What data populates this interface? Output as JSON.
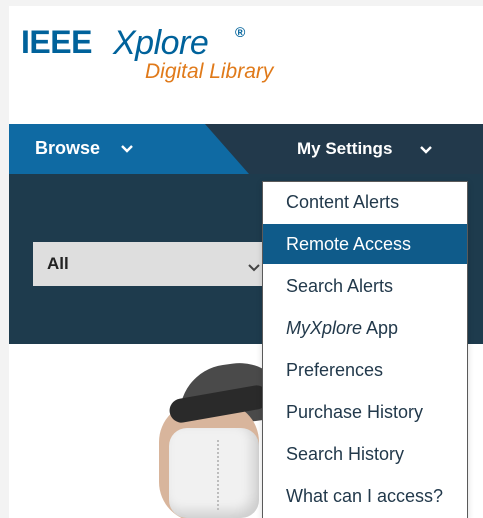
{
  "logo": {
    "ieee": "IEEE",
    "xplore": "Xplore",
    "reg": "®",
    "subtitle": "Digital Library"
  },
  "nav": {
    "browse_label": "Browse",
    "settings_label": "My Settings"
  },
  "search": {
    "scope_value": "All"
  },
  "dropdown": {
    "items": [
      {
        "label": "Content Alerts"
      },
      {
        "label": "Remote Access"
      },
      {
        "label": "Search Alerts"
      },
      {
        "label_italic": "MyXplore",
        "label_rest": " App"
      },
      {
        "label": "Preferences"
      },
      {
        "label": "Purchase History"
      },
      {
        "label": "Search History"
      },
      {
        "label": "What can I access?"
      }
    ],
    "active_item": "Remote Access"
  },
  "colors": {
    "brand_blue": "#00629b",
    "orange": "#e07a1a",
    "nav_dark": "#22394b",
    "browse_blue": "#0f6aa3",
    "active_item": "#0f5b8a"
  },
  "icons": [
    "chevron-down-icon",
    "select-arrow-icon"
  ]
}
